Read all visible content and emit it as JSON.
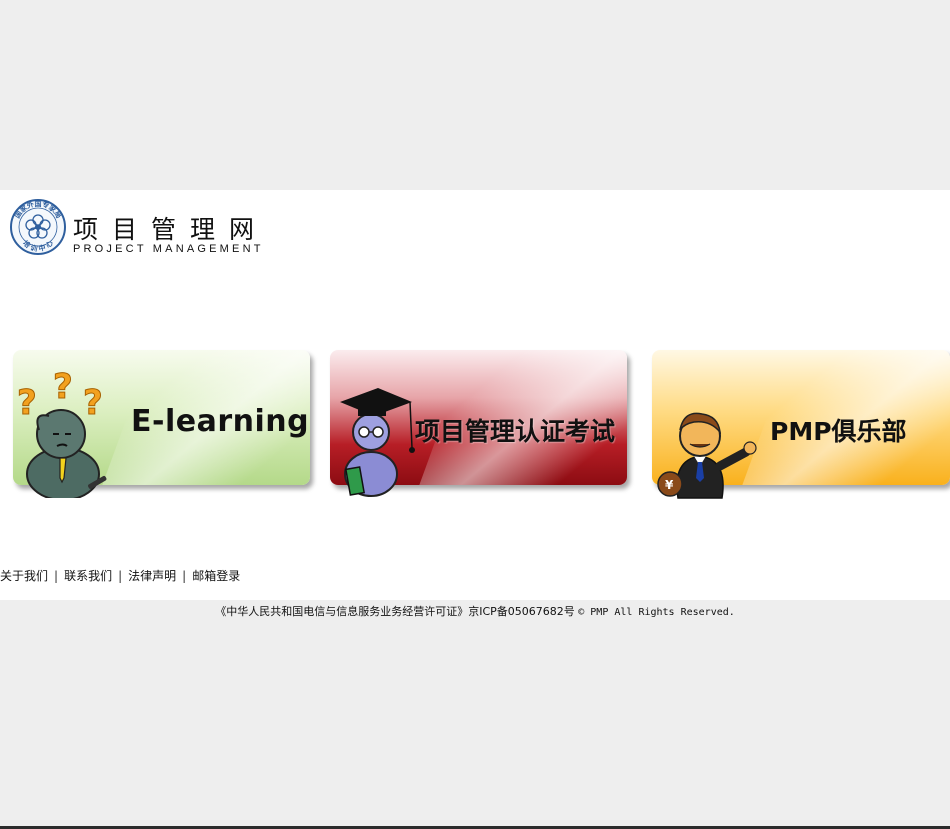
{
  "logo": {
    "seal_text_top": "国家外国专家局",
    "seal_text_bottom": "培 训 中 心",
    "title": "项目管理网",
    "subtitle": "PROJECT MANAGEMENT"
  },
  "banners": [
    {
      "label": "E-learning",
      "color": "#b4d989"
    },
    {
      "label": "项目管理认证考试",
      "color": "#8c0c12"
    },
    {
      "label": "PMP俱乐部",
      "color": "#f9b11d"
    }
  ],
  "footer": {
    "links": [
      "关于我们",
      "联系我们",
      "法律声明",
      "邮箱登录"
    ],
    "separator": "|"
  },
  "copyright": {
    "license": "《中华人民共和国电信与信息服务业务经营许可证》京ICP备05067682号",
    "rights": "© PMP All Rights Reserved."
  }
}
